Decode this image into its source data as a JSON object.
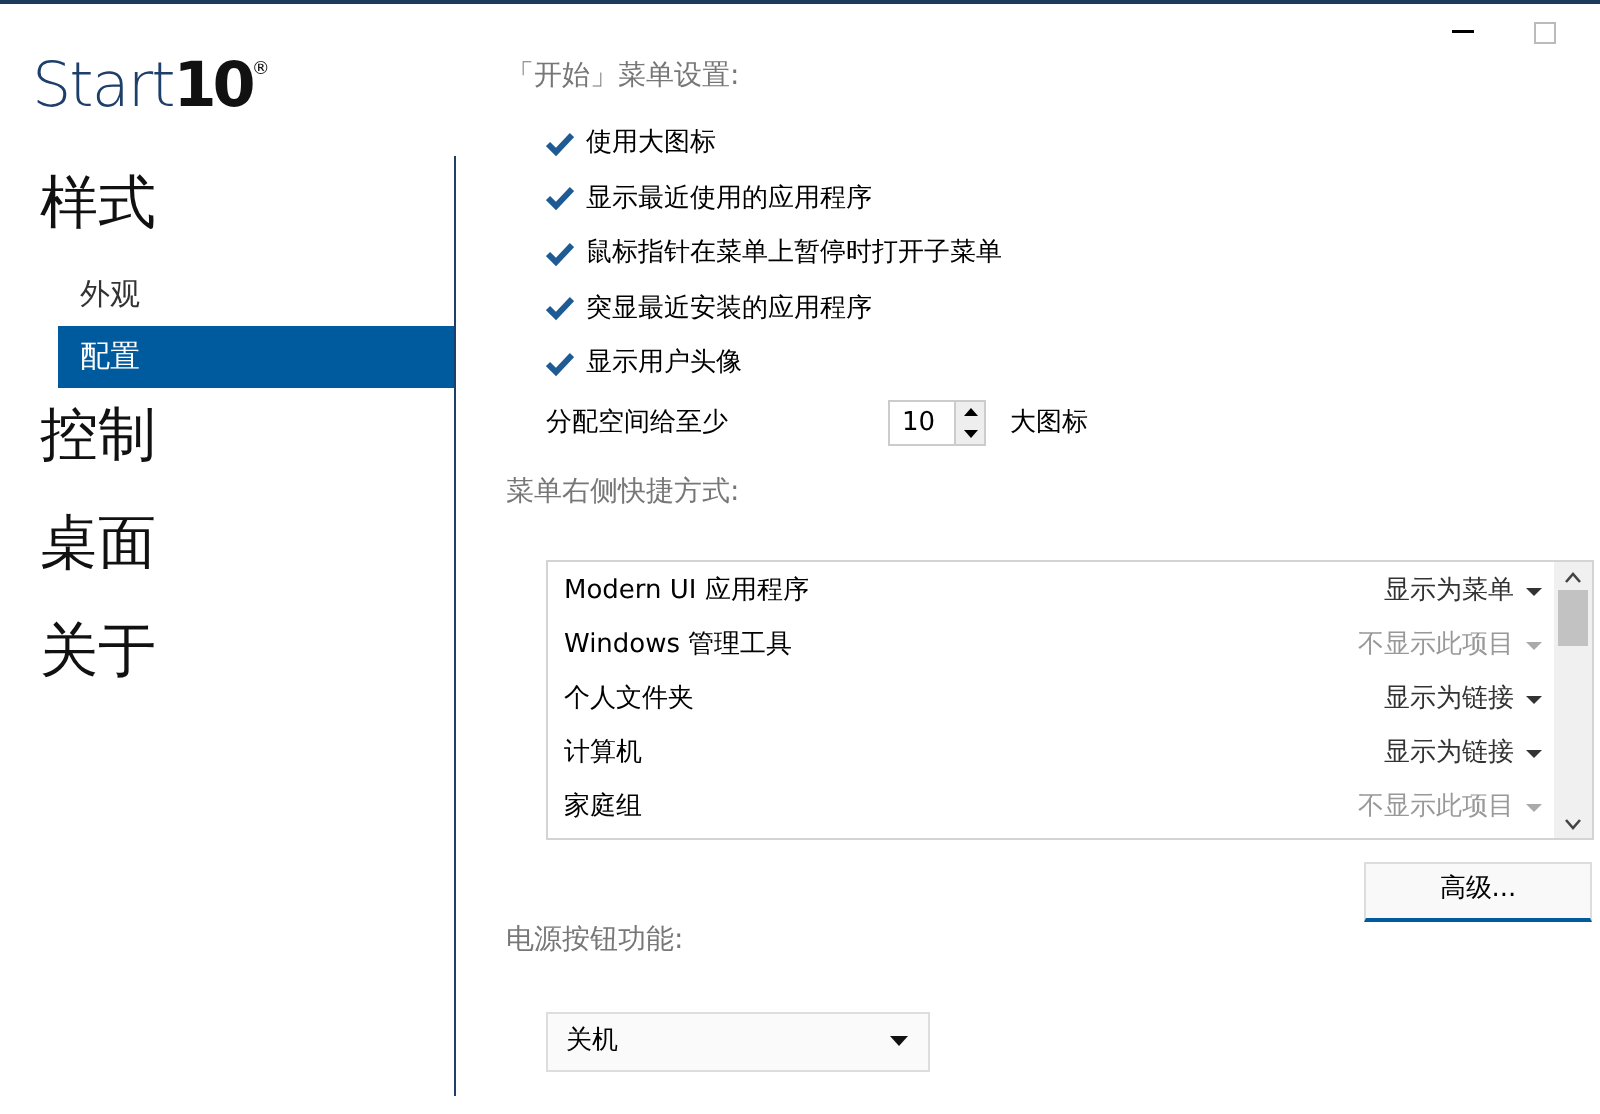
{
  "logo": {
    "text": "Start",
    "number": "10",
    "mark": "®"
  },
  "sidebar": {
    "sections": [
      {
        "label": "样式",
        "children": [
          {
            "label": "外观",
            "selected": false
          },
          {
            "label": "配置",
            "selected": true
          }
        ]
      },
      {
        "label": "控制"
      },
      {
        "label": "桌面"
      },
      {
        "label": "关于"
      }
    ]
  },
  "start_menu_settings": {
    "title": "「开始」菜单设置:",
    "options": [
      {
        "label": "使用大图标",
        "checked": true
      },
      {
        "label": "显示最近使用的应用程序",
        "checked": true
      },
      {
        "label": "鼠标指针在菜单上暂停时打开子菜单",
        "checked": true
      },
      {
        "label": "突显最近安装的应用程序",
        "checked": true
      },
      {
        "label": "显示用户头像",
        "checked": true
      }
    ],
    "space": {
      "label": "分配空间给至少",
      "value": "10",
      "unit": "大图标"
    }
  },
  "shortcuts": {
    "title": "菜单右侧快捷方式:",
    "items": [
      {
        "label": "Modern UI 应用程序",
        "option": "显示为菜单",
        "disabled": false
      },
      {
        "label": "Windows 管理工具",
        "option": "不显示此项目",
        "disabled": true
      },
      {
        "label": "个人文件夹",
        "option": "显示为链接",
        "disabled": false
      },
      {
        "label": "计算机",
        "option": "显示为链接",
        "disabled": false
      },
      {
        "label": "家庭组",
        "option": "不显示此项目",
        "disabled": true
      }
    ],
    "advanced_button": "高级..."
  },
  "power_button": {
    "title": "电源按钮功能:",
    "value": "关机"
  }
}
